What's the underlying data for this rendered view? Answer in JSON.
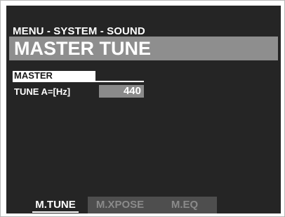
{
  "header": {
    "breadcrumb": "MENU - SYSTEM - SOUND",
    "title": "MASTER TUNE"
  },
  "section": {
    "label": "MASTER"
  },
  "parameter": {
    "label": "TUNE  A=[Hz]",
    "value": "440"
  },
  "tabs": [
    {
      "label": "M.TUNE",
      "active": true
    },
    {
      "label": "M.XPOSE",
      "active": false
    },
    {
      "label": "M.EQ",
      "active": false
    }
  ],
  "colors": {
    "screen_background": "#252525",
    "title_bar": "#8e8e8e",
    "value_box": "#8a8a8a",
    "inactive_tab": "#4e4e4e",
    "inactive_tab_text": "#8a8a8a",
    "text": "#ffffff"
  }
}
